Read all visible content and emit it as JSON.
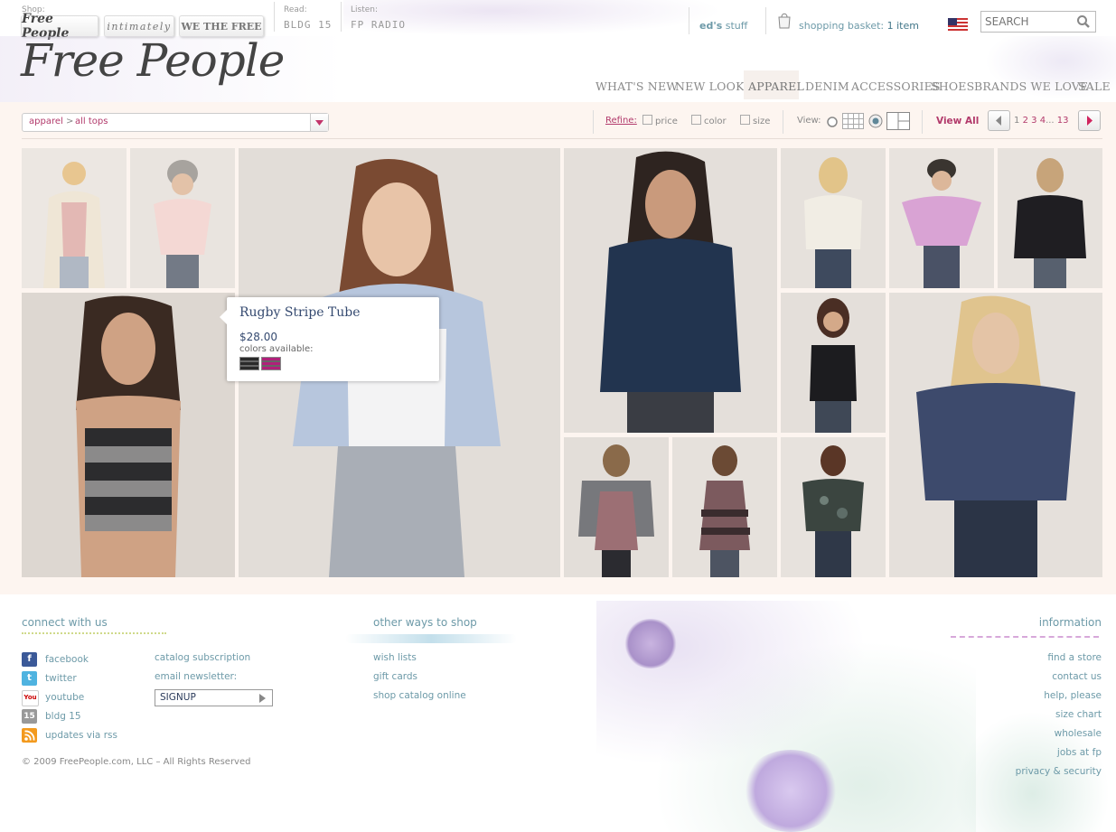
{
  "topbar": {
    "shop_label": "Shop:",
    "shop_free_people": "Free People",
    "shop_intimately": "intimately",
    "shop_we_the_free": "WE THE FREE",
    "read_label": "Read:",
    "read_link": "BLDG 15",
    "listen_label": "Listen:",
    "listen_link": "FP RADIO",
    "account_name": "ed's",
    "account_suffix": "stuff",
    "basket_label": "shopping basket:",
    "basket_count": "1 item",
    "search_placeholder": "SEARCH"
  },
  "logo_text": "Free People",
  "nav": [
    "WHAT'S NEW",
    "NEW LOOKS",
    "APPAREL",
    "DENIM",
    "ACCESSORIES",
    "SHOES",
    "BRANDS WE LOVE",
    "SALE"
  ],
  "toolbar": {
    "crumb_root": "apparel",
    "crumb_sep": ">",
    "crumb_current": "all tops",
    "refine_label": "Refine:",
    "refine_price": "price",
    "refine_color": "color",
    "refine_size": "size",
    "view_label": "View:",
    "view_all": "View All",
    "pages": [
      "1",
      "2",
      "3",
      "4"
    ],
    "pages_ellipsis": "...",
    "pages_last": "13"
  },
  "tooltip": {
    "name": "Rugby Stripe Tube",
    "price": "$28.00",
    "colors_label": "colors available:",
    "swatches": [
      "#2a2a2a",
      "#b0207a"
    ]
  },
  "footer": {
    "connect_title": "connect with us",
    "social": [
      {
        "icon": "facebook-icon",
        "label": "facebook",
        "color": "#3b5998"
      },
      {
        "icon": "twitter-icon",
        "label": "twitter",
        "color": "#4fb3e0"
      },
      {
        "icon": "youtube-icon",
        "label": "youtube",
        "color": "#ffffff"
      },
      {
        "icon": "bldg15-icon",
        "label": "bldg 15",
        "color": "#999999"
      },
      {
        "icon": "rss-icon",
        "label": "updates via rss",
        "color": "#f39a1e"
      }
    ],
    "catalog_subscription": "catalog subscription",
    "email_newsletter": "email newsletter:",
    "signup_label": "SIGNUP",
    "other_title": "other ways to shop",
    "other_links": [
      "wish lists",
      "gift cards",
      "shop catalog online"
    ],
    "info_title": "information",
    "info_links": [
      "find a store",
      "contact us",
      "help, please",
      "size chart",
      "wholesale",
      "jobs at fp",
      "privacy & security"
    ],
    "copyright": "© 2009 FreePeople.com, LLC – All Rights Reserved"
  },
  "colors": {
    "accent_pink": "#b23a6b",
    "link_teal": "#6d9aa8",
    "page_tint": "#fdf5f0"
  }
}
